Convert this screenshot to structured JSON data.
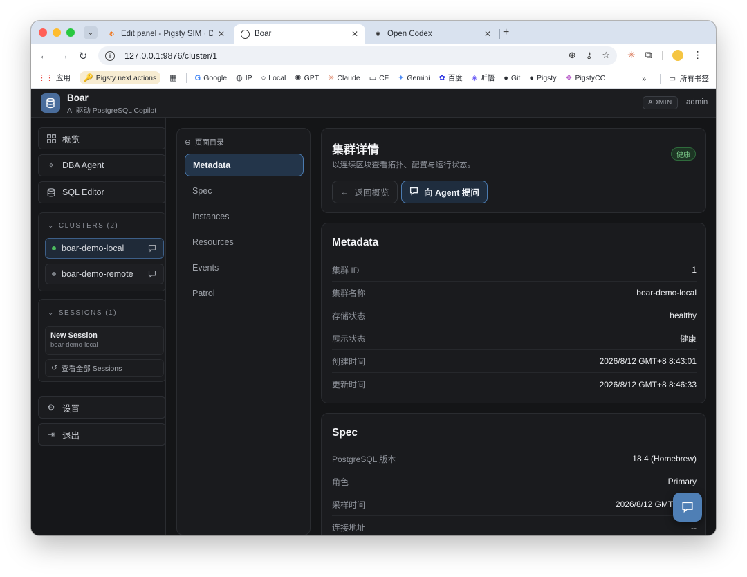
{
  "browser": {
    "tabs": [
      {
        "label": "Edit panel - Pigsty SIM · Digi",
        "icon": "grafana-icon"
      },
      {
        "label": "Boar",
        "icon": "globe-icon"
      },
      {
        "label": "Open Codex",
        "icon": "openai-icon"
      }
    ],
    "url": "127.0.0.1:9876/cluster/1",
    "bookmarks": [
      {
        "label": "应用",
        "icon": "apps-grid-icon"
      },
      {
        "label": "Pigsty next actions",
        "icon": "key-icon"
      },
      {
        "label": "",
        "icon": "grid-icon"
      },
      {
        "label": "Google",
        "icon": "google-icon"
      },
      {
        "label": "IP",
        "icon": "globe-icon"
      },
      {
        "label": "Local",
        "icon": "circle-icon"
      },
      {
        "label": "GPT",
        "icon": "openai-icon"
      },
      {
        "label": "Claude",
        "icon": "claude-icon"
      },
      {
        "label": "CF",
        "icon": "folder-icon"
      },
      {
        "label": "Gemini",
        "icon": "gemini-icon"
      },
      {
        "label": "百度",
        "icon": "baidu-icon"
      },
      {
        "label": "听悟",
        "icon": "tingwu-icon"
      },
      {
        "label": "Git",
        "icon": "github-icon"
      },
      {
        "label": "Pigsty",
        "icon": "github-icon"
      },
      {
        "label": "PigstyCC",
        "icon": "pigsty-icon"
      }
    ],
    "bookmarks_more": "»",
    "all_bookmarks": "所有书签"
  },
  "app": {
    "title": "Boar",
    "subtitle": "AI 驱动 PostgreSQL Copilot",
    "role": "ADMIN",
    "user": "admin"
  },
  "sidebar": {
    "nav": [
      {
        "label": "概览",
        "icon": "dashboard-icon"
      },
      {
        "label": "DBA Agent",
        "icon": "sparkle-icon"
      },
      {
        "label": "SQL Editor",
        "icon": "database-icon"
      }
    ],
    "clusters_header": "CLUSTERS (2)",
    "clusters": [
      {
        "label": "boar-demo-local",
        "status_color": "#4cbb5f"
      },
      {
        "label": "boar-demo-remote",
        "status_color": "#7b7f86"
      }
    ],
    "sessions_header": "SESSIONS (1)",
    "session": {
      "title": "New Session",
      "cluster": "boar-demo-local"
    },
    "view_all_sessions": "查看全部 Sessions",
    "settings": "设置",
    "logout": "退出"
  },
  "toc": {
    "title": "页面目录",
    "items": [
      "Metadata",
      "Spec",
      "Instances",
      "Resources",
      "Events",
      "Patrol"
    ],
    "active": "Metadata"
  },
  "detail": {
    "title": "集群详情",
    "subtitle": "以连续区块查看拓扑、配置与运行状态。",
    "health_badge": "健康",
    "back_button": "返回概览",
    "ask_button": "向 Agent 提问"
  },
  "metadata": {
    "title": "Metadata",
    "rows": [
      {
        "key": "集群 ID",
        "value": "1"
      },
      {
        "key": "集群名称",
        "value": "boar-demo-local"
      },
      {
        "key": "存储状态",
        "value": "healthy"
      },
      {
        "key": "展示状态",
        "value": "健康"
      },
      {
        "key": "创建时间",
        "value": "2026/8/12 GMT+8 8:43:01"
      },
      {
        "key": "更新时间",
        "value": "2026/8/12 GMT+8 8:46:33"
      }
    ]
  },
  "spec": {
    "title": "Spec",
    "rows": [
      {
        "key": "PostgreSQL 版本",
        "value": "18.4 (Homebrew)"
      },
      {
        "key": "角色",
        "value": "Primary"
      },
      {
        "key": "采样时间",
        "value": "2026/8/12 GMT+8 8:4"
      },
      {
        "key": "连接地址",
        "value": "--"
      }
    ]
  },
  "colors": {
    "accent": "#4f7fb5",
    "healthy": "#7fd08e",
    "background": "#141517"
  }
}
